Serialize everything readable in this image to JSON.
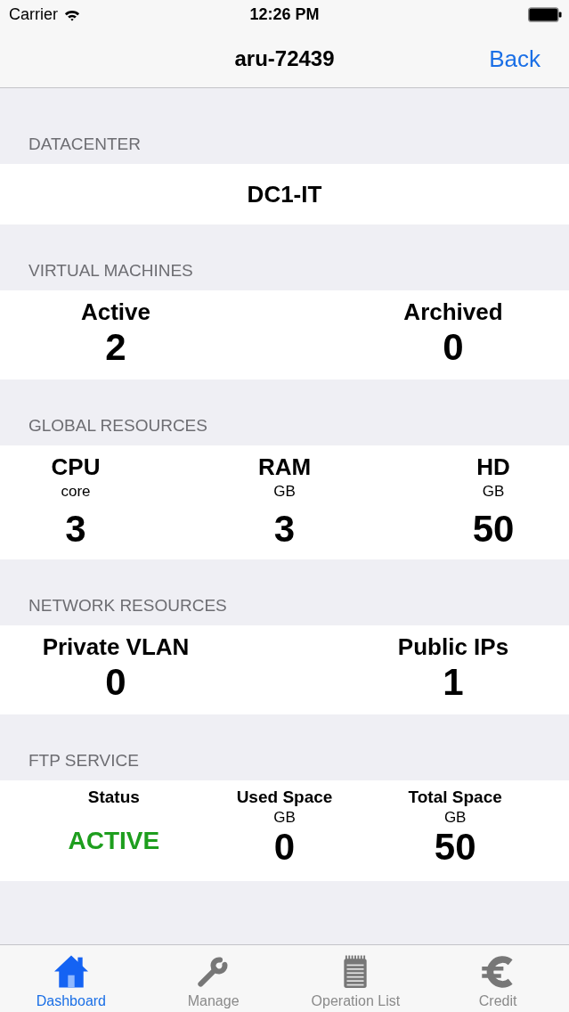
{
  "status_bar": {
    "carrier": "Carrier",
    "time": "12:26 PM"
  },
  "nav_bar": {
    "title": "aru-72439",
    "back": "Back"
  },
  "sections": [
    {
      "header": "DATACENTER",
      "kind": "single",
      "items": [
        {
          "value": "DC1-IT"
        }
      ]
    },
    {
      "header": "VIRTUAL MACHINES",
      "kind": "pair",
      "items": [
        {
          "label": "Active",
          "value": "2"
        },
        {
          "label": "Archived",
          "value": "0"
        }
      ]
    },
    {
      "header": "GLOBAL RESOURCES",
      "kind": "triple",
      "items": [
        {
          "label": "CPU",
          "unit": "core",
          "value": "3"
        },
        {
          "label": "RAM",
          "unit": "GB",
          "value": "3"
        },
        {
          "label": "HD",
          "unit": "GB",
          "value": "50"
        }
      ]
    },
    {
      "header": "NETWORK RESOURCES",
      "kind": "pair",
      "items": [
        {
          "label": "Private VLAN",
          "value": "0"
        },
        {
          "label": "Public IPs",
          "value": "1"
        }
      ]
    },
    {
      "header": "FTP SERVICE",
      "kind": "service",
      "items": [
        {
          "label": "Status",
          "kind": "status",
          "value": "ACTIVE",
          "color": "#1e9e1e"
        },
        {
          "label": "Used Space",
          "unit": "GB",
          "value": "0"
        },
        {
          "label": "Total Space",
          "unit": "GB",
          "value": "50"
        }
      ]
    }
  ],
  "tabs": [
    {
      "label": "Dashboard",
      "selected": true
    },
    {
      "label": "Manage",
      "selected": false
    },
    {
      "label": "Operation List",
      "selected": false
    },
    {
      "label": "Credit",
      "selected": false
    }
  ]
}
